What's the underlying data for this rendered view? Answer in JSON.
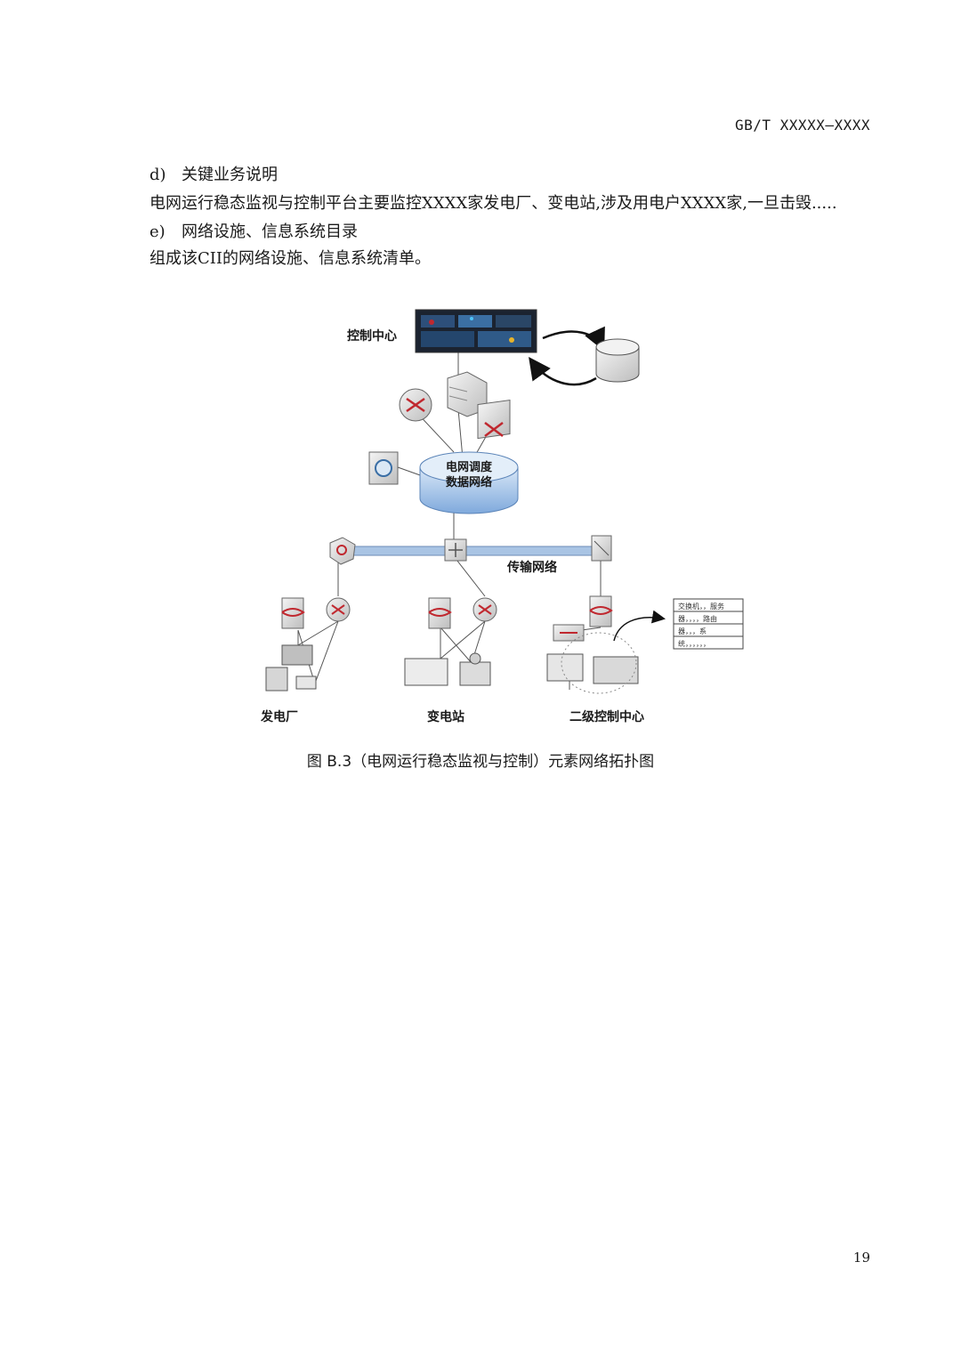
{
  "header": {
    "std_code": "GB/T XXXXX—XXXX"
  },
  "body": {
    "item_d_marker": "d)",
    "item_d_title": "关键业务说明",
    "item_d_text": "电网运行稳态监视与控制平台主要监控XXXX家发电厂、变电站,涉及用电户XXXX家,一旦击毁.....",
    "item_e_marker": "e)",
    "item_e_title": "网络设施、信息系统目录",
    "item_e_text": "组成该CII的网络设施、信息系统清单。"
  },
  "figure": {
    "control_center_label": "控制中心",
    "core_network_label_line1": "电网调度",
    "core_network_label_line2": "数据网络",
    "transport_network_label": "传输网络",
    "power_plant_label": "发电厂",
    "substation_label": "变电站",
    "secondary_center_label": "二级控制中心",
    "list_box_rows": [
      "交换机，，服务",
      "器，，，，路由",
      "器，，，系",
      "统，，，，，，"
    ],
    "icons": [
      "monitor-wall-icon",
      "database-icon",
      "router-icon",
      "server-icon",
      "switch-icon",
      "scanner-icon",
      "firewall-icon",
      "plant-device-icon",
      "substation-device-icon",
      "workstation-icon"
    ],
    "colors": {
      "bus": "#a9c4e4",
      "cloud": "#9cbfe6",
      "accent_red": "#c0282f"
    }
  },
  "caption": "图 B.3（电网运行稳态监视与控制）元素网络拓扑图",
  "page_number": "19"
}
